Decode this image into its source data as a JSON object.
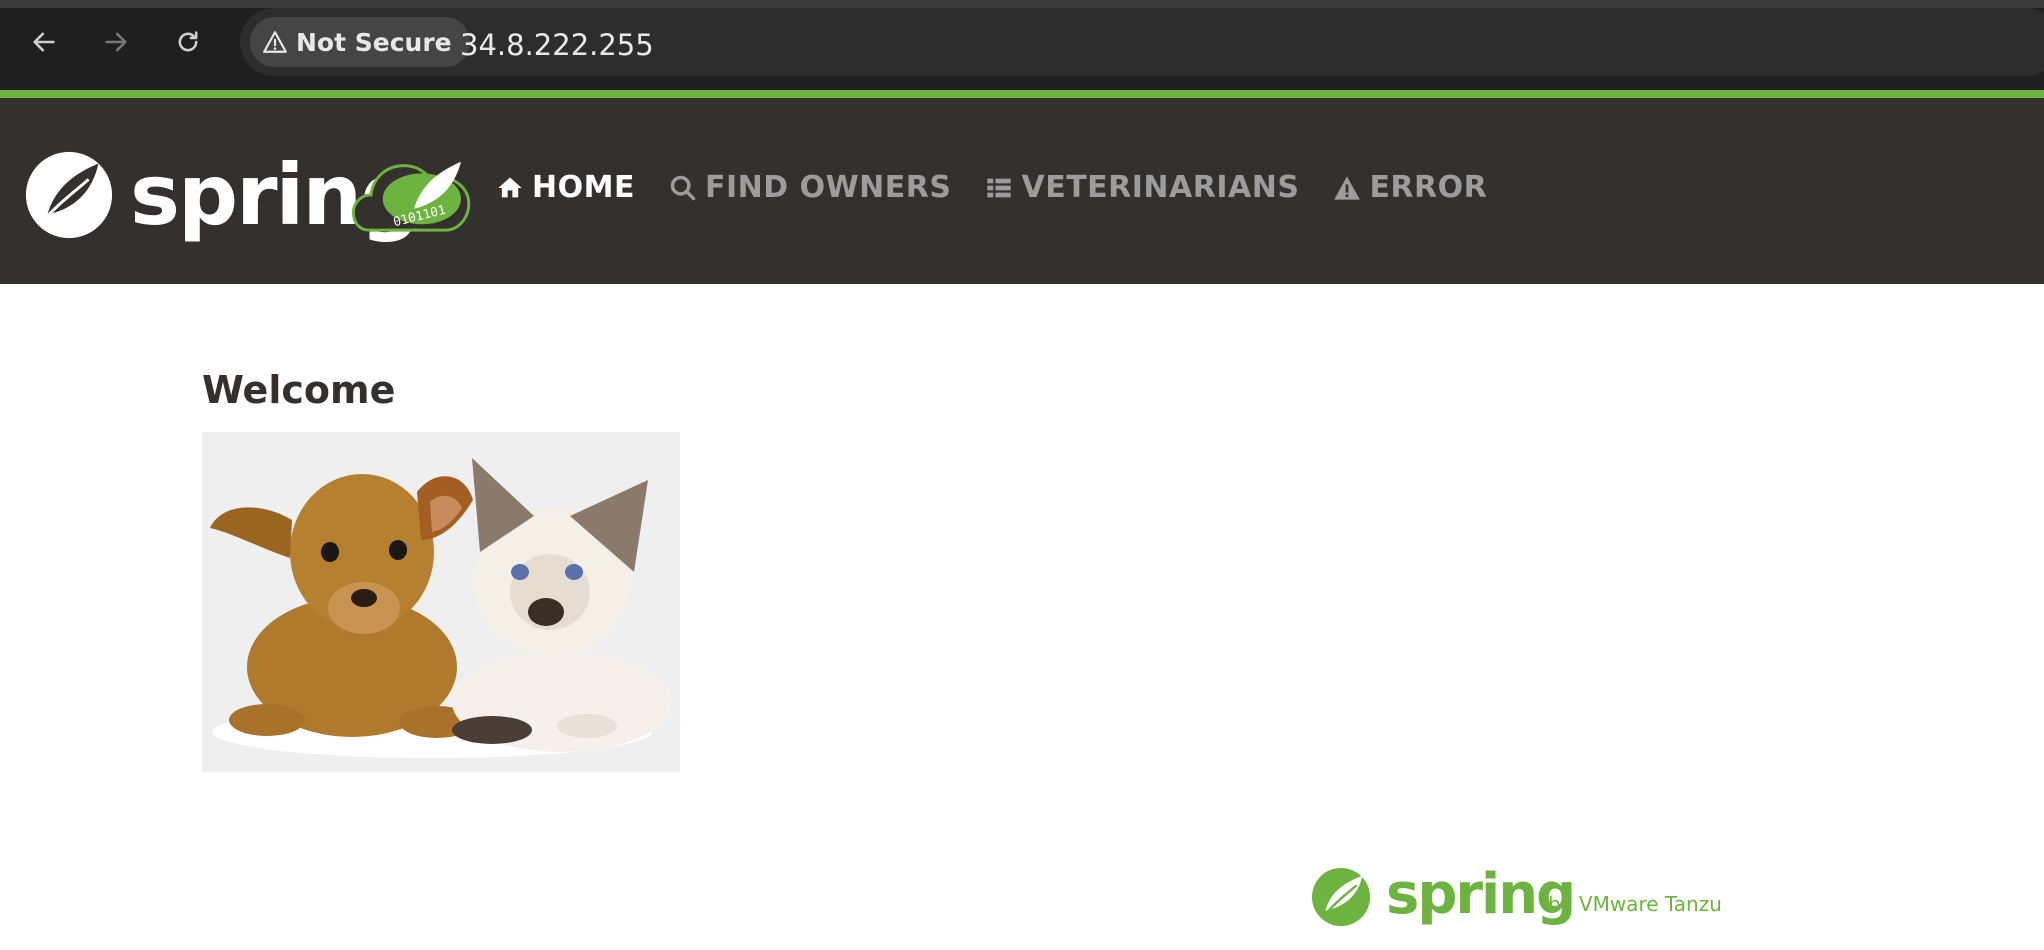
{
  "browser": {
    "security_label": "Not Secure",
    "url": "34.8.222.255"
  },
  "header": {
    "brand": "spring",
    "nav": [
      {
        "label": "HOME",
        "icon": "home-icon",
        "active": true
      },
      {
        "label": "FIND OWNERS",
        "icon": "search-icon",
        "active": false
      },
      {
        "label": "VETERINARIANS",
        "icon": "list-icon",
        "active": false
      },
      {
        "label": "ERROR",
        "icon": "warning-icon",
        "active": false
      }
    ]
  },
  "main": {
    "title": "Welcome",
    "image_alt": "puppy-and-kitten"
  },
  "footer": {
    "brand": "spring",
    "byline": "by VMware Tanzu"
  },
  "colors": {
    "accent": "#6db33f",
    "header_bg": "#34302d",
    "nav_inactive": "#9c9c9c"
  }
}
